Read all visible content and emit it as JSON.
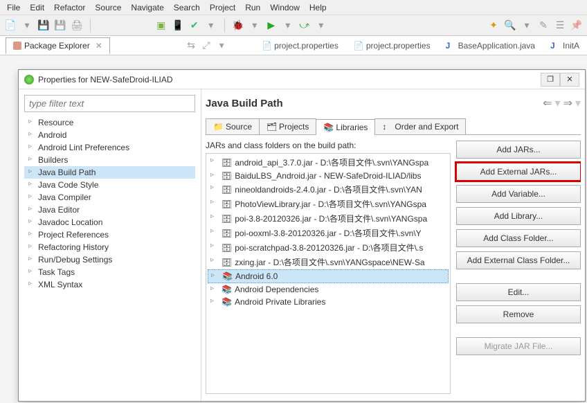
{
  "menu": [
    "File",
    "Edit",
    "Refactor",
    "Source",
    "Navigate",
    "Search",
    "Project",
    "Run",
    "Window",
    "Help"
  ],
  "editor_tabs": [
    {
      "label": "Package Explorer",
      "active": true,
      "icon": "package-icon"
    },
    {
      "label": "project.properties",
      "icon": "file-icon"
    },
    {
      "label": "project.properties",
      "icon": "file-icon"
    },
    {
      "label": "BaseApplication.java",
      "icon": "java-icon"
    },
    {
      "label": "InitA",
      "icon": "java-icon"
    }
  ],
  "dialog": {
    "title": "Properties for NEW-SafeDroid-ILIAD",
    "filter_placeholder": "type filter text",
    "tree": [
      "Resource",
      "Android",
      "Android Lint Preferences",
      "Builders",
      "Java Build Path",
      "Java Code Style",
      "Java Compiler",
      "Java Editor",
      "Javadoc Location",
      "Project References",
      "Refactoring History",
      "Run/Debug Settings",
      "Task Tags",
      "XML Syntax"
    ],
    "tree_selected": "Java Build Path",
    "right_title": "Java Build Path",
    "tabs": [
      {
        "label": "Source",
        "icon": "folder-icon"
      },
      {
        "label": "Projects",
        "icon": "folder-proj-icon"
      },
      {
        "label": "Libraries",
        "icon": "library-icon",
        "active": true
      },
      {
        "label": "Order and Export",
        "icon": "order-icon"
      }
    ],
    "jar_caption": "JARs and class folders on the build path:",
    "jars": [
      {
        "label": "android_api_3.7.0.jar - D:\\各项目文件\\.svn\\YANGspa",
        "icon": "jar-icon"
      },
      {
        "label": "BaiduLBS_Android.jar - NEW-SafeDroid-ILIAD/libs",
        "icon": "jar-icon"
      },
      {
        "label": "nineoldandroids-2.4.0.jar - D:\\各项目文件\\.svn\\YAN",
        "icon": "jar-icon"
      },
      {
        "label": "PhotoViewLibrary.jar - D:\\各项目文件\\.svn\\YANGspa",
        "icon": "jar-icon"
      },
      {
        "label": "poi-3.8-20120326.jar - D:\\各项目文件\\.svn\\YANGspa",
        "icon": "jar-icon"
      },
      {
        "label": "poi-ooxml-3.8-20120326.jar - D:\\各项目文件\\.svn\\Y",
        "icon": "jar-icon"
      },
      {
        "label": "poi-scratchpad-3.8-20120326.jar - D:\\各项目文件\\.s",
        "icon": "jar-icon"
      },
      {
        "label": "zxing.jar - D:\\各项目文件\\.svn\\YANGspace\\NEW-Sa",
        "icon": "jar-icon"
      },
      {
        "label": "Android 6.0",
        "icon": "lib-folder-icon",
        "selected": true
      },
      {
        "label": "Android Dependencies",
        "icon": "lib-folder-icon"
      },
      {
        "label": "Android Private Libraries",
        "icon": "lib-folder-icon"
      }
    ],
    "buttons": {
      "add_jars": "Add JARs...",
      "add_ext_jars": "Add External JARs...",
      "add_var": "Add Variable...",
      "add_lib": "Add Library...",
      "add_class": "Add Class Folder...",
      "add_ext_class": "Add External Class Folder...",
      "edit": "Edit...",
      "remove": "Remove",
      "migrate": "Migrate JAR File..."
    }
  },
  "icons": {
    "jar": "🗄",
    "libfolder": "📚",
    "folder": "📁",
    "java": "J",
    "file": "📄",
    "arrow_left": "⇐",
    "arrow_right": "⇒",
    "dropdown": "▾",
    "close": "✕",
    "restore": "❐",
    "triangle": "▹"
  }
}
